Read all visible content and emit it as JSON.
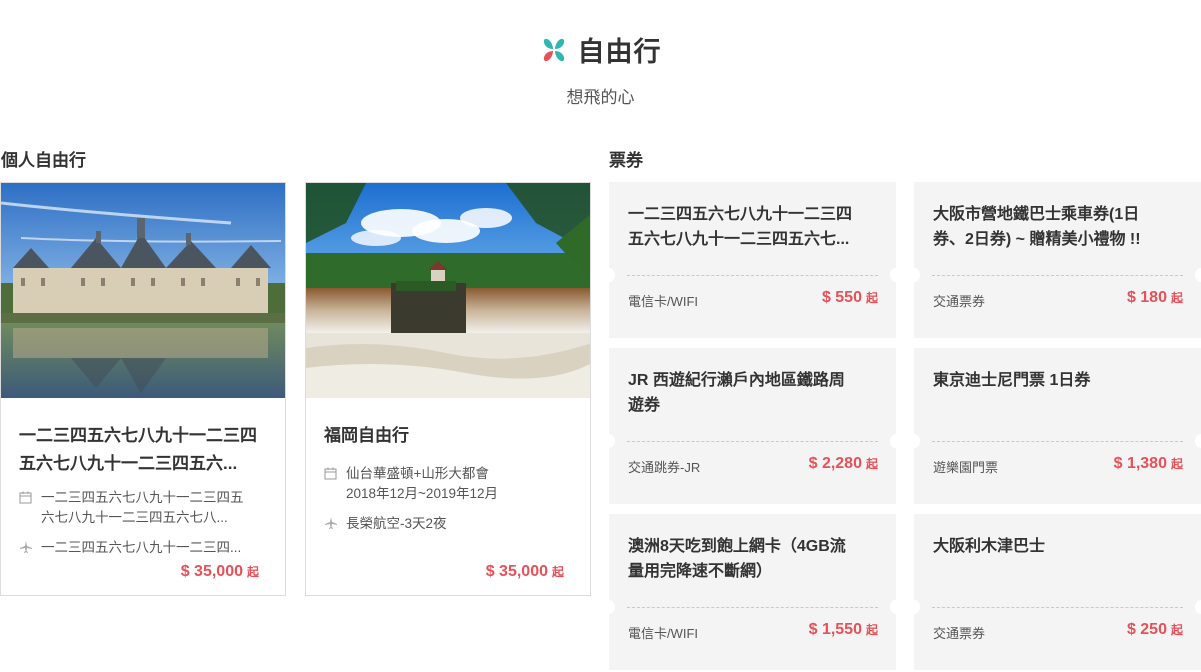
{
  "header": {
    "title": "自由行",
    "subtitle": "想飛的心",
    "logo_icon": "flower-logo-icon",
    "logo_colors": [
      "#2fb7b0",
      "#e6515a"
    ]
  },
  "sections": {
    "tours_label": "個人自由行",
    "tickets_label": "票券"
  },
  "tours": [
    {
      "name_line1": "一二三四五六七八九十一二三四",
      "name_line2": "五六七八九十一二三四五六...",
      "schedule_line1": "一二三四五六七八九十一二三四五",
      "schedule_line2": "六七八九十一二三四五六七八...",
      "airline": "一二三四五六七八九十一二三四...",
      "price": "$ 35,000",
      "price_suffix": "起",
      "image": "chateau-photo"
    },
    {
      "name_line1": "福岡自由行",
      "name_line2": "",
      "schedule_line1": "仙台華盛頓+山形大都會",
      "schedule_line2": "2018年12月~2019年12月",
      "airline": "長榮航空-3天2夜",
      "price": "$ 35,000",
      "price_suffix": "起",
      "image": "waterfall-photo"
    }
  ],
  "tickets": [
    {
      "name": "一二三四五六七八九十一二三四五六七八九十一二三四五六七...",
      "line1": "一二三四五六七八九十一二三四",
      "line2": "五六七八九十一二三四五六七...",
      "category": "電信卡/WIFI",
      "price": "$ 550",
      "suffix": "起"
    },
    {
      "name": "大阪市營地鐵巴士乘車券(1日券、2日券) ~ 贈精美小禮物 !!",
      "line1": "大阪市營地鐵巴士乘車券(1日",
      "line2": "券、2日券) ~ 贈精美小禮物 !!",
      "category": "交通票券",
      "price": "$ 180",
      "suffix": "起"
    },
    {
      "name": "JR 西遊紀行瀨戶內地區鐵路周遊券",
      "line1": "JR 西遊紀行瀨戶內地區鐵路周",
      "line2": "遊券",
      "category": "交通跳券-JR",
      "price": "$ 2,280",
      "suffix": "起"
    },
    {
      "name": "東京迪士尼門票 1日券",
      "line1": "東京迪士尼門票 1日券",
      "line2": "",
      "category": "遊樂園門票",
      "price": "$ 1,380",
      "suffix": "起"
    },
    {
      "name": "澳洲8天吃到飽上網卡（4GB流量用完降速不斷網）",
      "line1": "澳洲8天吃到飽上網卡（4GB流",
      "line2": "量用完降速不斷網）",
      "category": "電信卡/WIFI",
      "price": "$ 1,550",
      "suffix": "起"
    },
    {
      "name": "大阪利木津巴士",
      "line1": "大阪利木津巴士",
      "line2": "",
      "category": "交通票券",
      "price": "$ 250",
      "suffix": "起"
    }
  ],
  "colors": {
    "price": "#e6515a",
    "ticket_bg": "#f4f4f4"
  }
}
